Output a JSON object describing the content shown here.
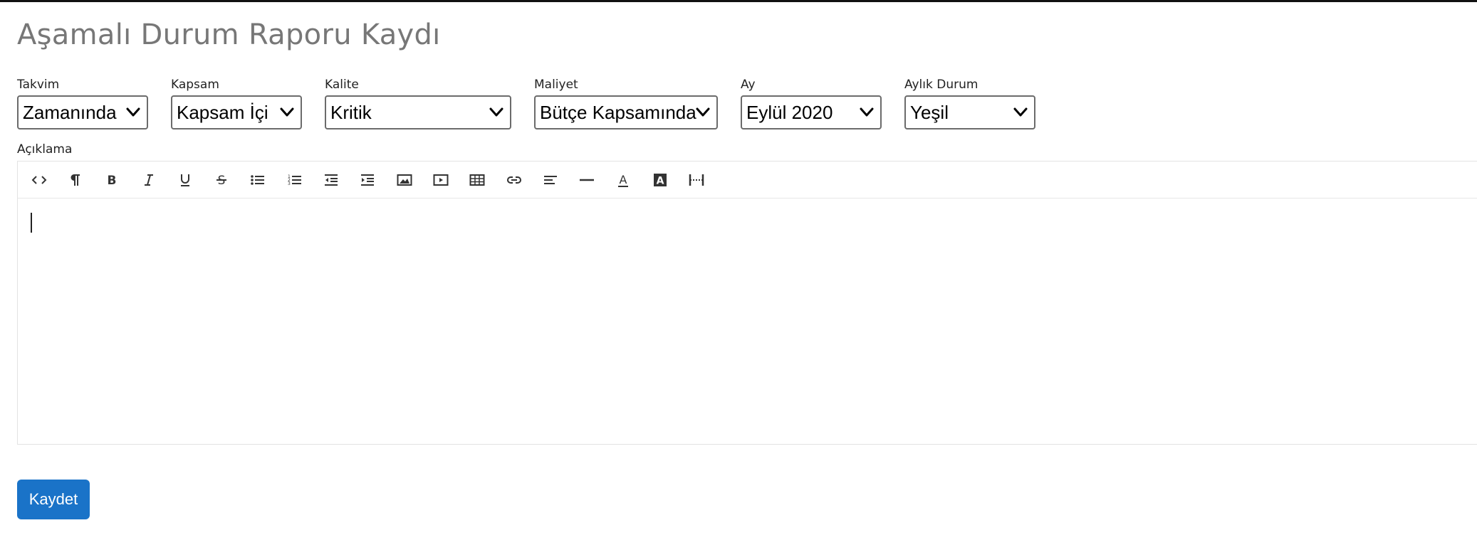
{
  "page": {
    "title": "Aşamalı Durum Raporu Kaydı"
  },
  "fields": {
    "takvim": {
      "label": "Takvim",
      "value": "Zamanında"
    },
    "kapsam": {
      "label": "Kapsam",
      "value": "Kapsam İçi"
    },
    "kalite": {
      "label": "Kalite",
      "value": "Kritik"
    },
    "maliyet": {
      "label": "Maliyet",
      "value": "Bütçe Kapsamında"
    },
    "ay": {
      "label": "Ay",
      "value": "Eylül 2020"
    },
    "aylik_durum": {
      "label": "Aylık Durum",
      "value": "Yeşil"
    }
  },
  "description": {
    "label": "Açıklama",
    "toolbar": [
      "code-view-icon",
      "paragraph-icon",
      "bold-icon",
      "italic-icon",
      "underline-icon",
      "strikethrough-icon",
      "bullet-list-icon",
      "numbered-list-icon",
      "outdent-icon",
      "indent-icon",
      "image-icon",
      "video-icon",
      "table-icon",
      "link-icon",
      "align-left-icon",
      "horizontal-rule-icon",
      "font-color-icon",
      "background-color-icon",
      "page-break-icon"
    ]
  },
  "actions": {
    "save_label": "Kaydet"
  },
  "colors": {
    "primary": "#1a73c8",
    "title": "#777777"
  }
}
